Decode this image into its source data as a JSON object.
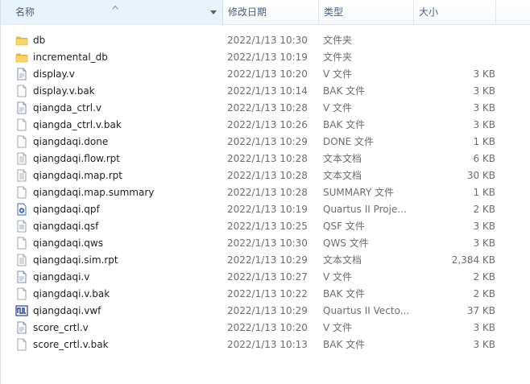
{
  "columns": {
    "name": "名称",
    "date": "修改日期",
    "type": "类型",
    "size": "大小"
  },
  "files": [
    {
      "name": "db",
      "date": "2022/1/13 10:30",
      "type": "文件夹",
      "size": "",
      "icon": "folder-icon"
    },
    {
      "name": "incremental_db",
      "date": "2022/1/13 10:19",
      "type": "文件夹",
      "size": "",
      "icon": "folder-icon"
    },
    {
      "name": "display.v",
      "date": "2022/1/13 10:20",
      "type": "V 文件",
      "size": "3 KB",
      "icon": "verilog-file-icon"
    },
    {
      "name": "display.v.bak",
      "date": "2022/1/13 10:14",
      "type": "BAK 文件",
      "size": "3 KB",
      "icon": "generic-file-icon"
    },
    {
      "name": "qiangda_ctrl.v",
      "date": "2022/1/13 10:28",
      "type": "V 文件",
      "size": "3 KB",
      "icon": "verilog-file-icon"
    },
    {
      "name": "qiangda_ctrl.v.bak",
      "date": "2022/1/13 10:26",
      "type": "BAK 文件",
      "size": "3 KB",
      "icon": "generic-file-icon"
    },
    {
      "name": "qiangdaqi.done",
      "date": "2022/1/13 10:29",
      "type": "DONE 文件",
      "size": "1 KB",
      "icon": "generic-file-icon"
    },
    {
      "name": "qiangdaqi.flow.rpt",
      "date": "2022/1/13 10:28",
      "type": "文本文档",
      "size": "6 KB",
      "icon": "text-file-icon"
    },
    {
      "name": "qiangdaqi.map.rpt",
      "date": "2022/1/13 10:28",
      "type": "文本文档",
      "size": "30 KB",
      "icon": "text-file-icon"
    },
    {
      "name": "qiangdaqi.map.summary",
      "date": "2022/1/13 10:28",
      "type": "SUMMARY 文件",
      "size": "1 KB",
      "icon": "generic-file-icon"
    },
    {
      "name": "qiangdaqi.qpf",
      "date": "2022/1/13 10:19",
      "type": "Quartus II Proje...",
      "size": "2 KB",
      "icon": "quartus-project-icon"
    },
    {
      "name": "qiangdaqi.qsf",
      "date": "2022/1/13 10:25",
      "type": "QSF 文件",
      "size": "3 KB",
      "icon": "settings-file-icon"
    },
    {
      "name": "qiangdaqi.qws",
      "date": "2022/1/13 10:30",
      "type": "QWS 文件",
      "size": "3 KB",
      "icon": "generic-file-icon"
    },
    {
      "name": "qiangdaqi.sim.rpt",
      "date": "2022/1/13 10:29",
      "type": "文本文档",
      "size": "2,384 KB",
      "icon": "text-file-icon"
    },
    {
      "name": "qiangdaqi.v",
      "date": "2022/1/13 10:27",
      "type": "V 文件",
      "size": "2 KB",
      "icon": "verilog-file-icon"
    },
    {
      "name": "qiangdaqi.v.bak",
      "date": "2022/1/13 10:22",
      "type": "BAK 文件",
      "size": "2 KB",
      "icon": "generic-file-icon"
    },
    {
      "name": "qiangdaqi.vwf",
      "date": "2022/1/13 10:29",
      "type": "Quartus II Vecto...",
      "size": "37 KB",
      "icon": "waveform-file-icon"
    },
    {
      "name": "score_crtl.v",
      "date": "2022/1/13 10:20",
      "type": "V 文件",
      "size": "3 KB",
      "icon": "verilog-file-icon"
    },
    {
      "name": "score_crtl.v.bak",
      "date": "2022/1/13 10:13",
      "type": "BAK 文件",
      "size": "3 KB",
      "icon": "generic-file-icon"
    }
  ]
}
